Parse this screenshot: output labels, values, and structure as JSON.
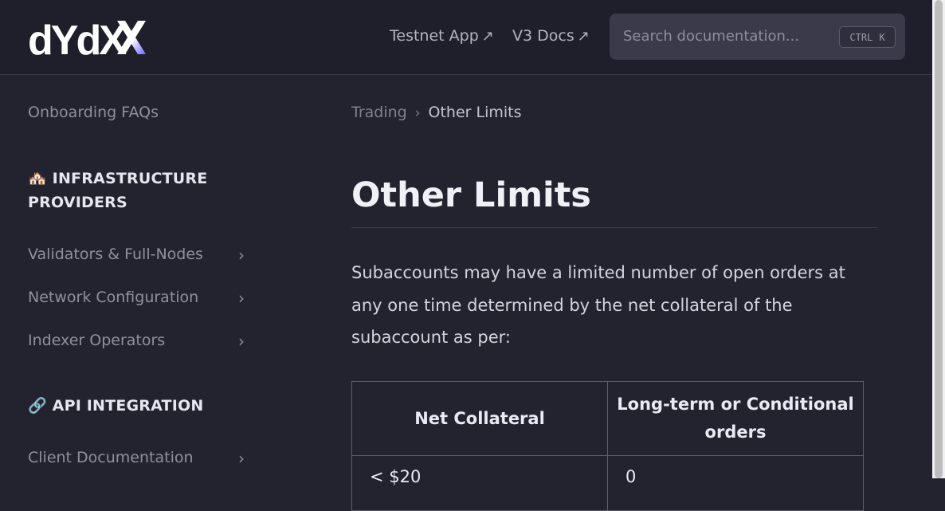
{
  "header": {
    "logo_text": "dYdX",
    "links": [
      {
        "label": "Testnet App",
        "icon": "external-arrow-icon"
      },
      {
        "label": "V3 Docs",
        "icon": "external-arrow-icon"
      }
    ],
    "search": {
      "placeholder": "Search documentation...",
      "shortcut_key1": "CTRL",
      "shortcut_key2": "K"
    }
  },
  "sidebar": {
    "top_link": "Onboarding FAQs",
    "sections": [
      {
        "title": "🏘️ INFRASTRUCTURE PROVIDERS",
        "items": [
          "Validators & Full-Nodes",
          "Network Configuration",
          "Indexer Operators"
        ]
      },
      {
        "title": "🔗 API INTEGRATION",
        "items": [
          "Client Documentation"
        ]
      }
    ]
  },
  "breadcrumb": {
    "parent": "Trading",
    "current": "Other Limits"
  },
  "main": {
    "title": "Other Limits",
    "paragraph": "Subaccounts may have a limited number of open orders at any one time determined by the net collateral of the subaccount as per:",
    "table": {
      "headers": [
        "Net Collateral",
        "Long-term or Conditional orders"
      ],
      "rows": [
        [
          "< $20",
          "0"
        ]
      ]
    }
  },
  "colors": {
    "background": "#232330",
    "header_background": "#1f1f2c",
    "accent_purple": "#6966ff"
  }
}
